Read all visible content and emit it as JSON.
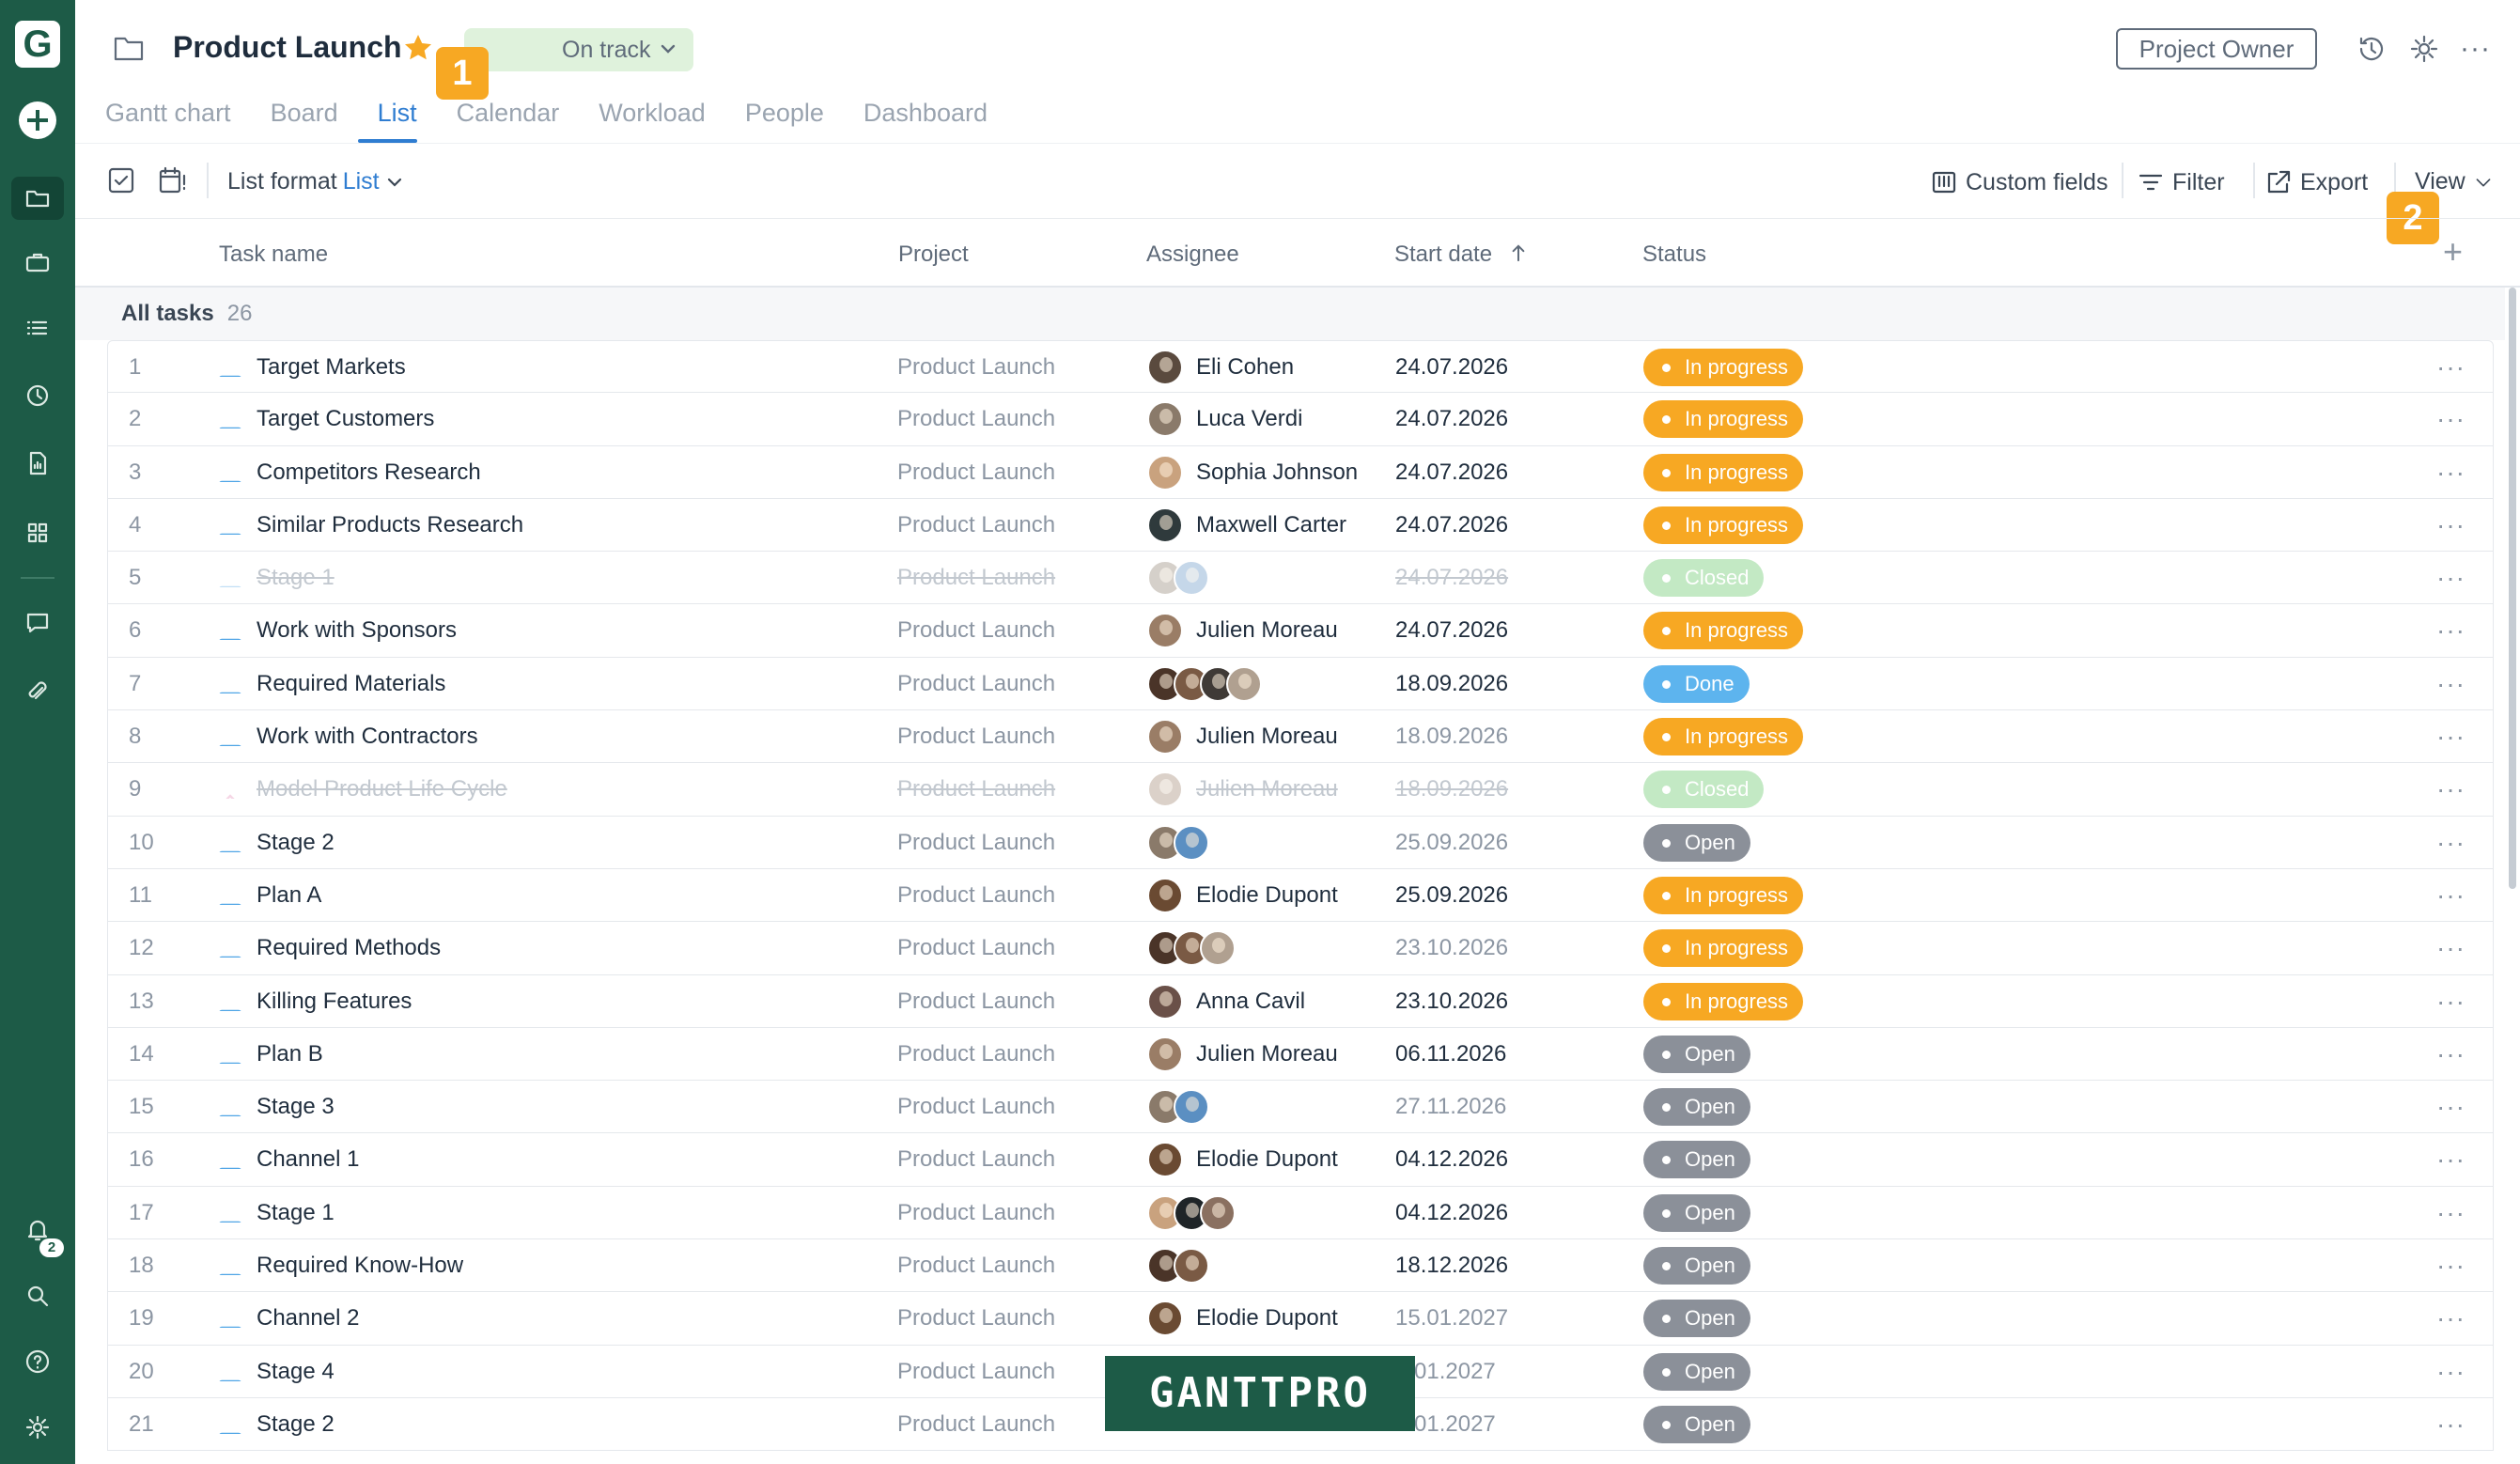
{
  "app": {
    "logo_letter": "G"
  },
  "sidebar": {
    "items": [
      {
        "name": "folder-icon",
        "active": true
      },
      {
        "name": "briefcase-icon"
      },
      {
        "name": "list-icon"
      },
      {
        "name": "clock-icon"
      },
      {
        "name": "report-icon"
      },
      {
        "name": "grid-icon"
      },
      {
        "name": "chat-icon"
      },
      {
        "name": "attachment-icon"
      }
    ],
    "notification_count": "2"
  },
  "header": {
    "title": "Product Launch",
    "status": "On track",
    "owner_button": "Project Owner",
    "tabs": [
      {
        "label": "Gantt chart"
      },
      {
        "label": "Board"
      },
      {
        "label": "List",
        "active": true
      },
      {
        "label": "Calendar"
      },
      {
        "label": "Workload"
      },
      {
        "label": "People"
      },
      {
        "label": "Dashboard"
      }
    ],
    "callout_1": "1",
    "callout_2": "2"
  },
  "toolbar": {
    "list_format_label": "List format",
    "list_format_value": "List",
    "custom_fields": "Custom fields",
    "filter": "Filter",
    "export": "Export",
    "view": "View"
  },
  "table": {
    "columns": {
      "task_name": "Task name",
      "project": "Project",
      "assignee": "Assignee",
      "start_date": "Start date",
      "status": "Status"
    },
    "group": {
      "label": "All tasks",
      "count": "26"
    },
    "rows": [
      {
        "num": "1",
        "name": "Target Markets",
        "project": "Product Launch",
        "assignee": "Eli Cohen",
        "avatars": [
          "#5a4a3e"
        ],
        "date": "24.07.2026",
        "date_muted": false,
        "status": "In progress",
        "kind": "progress"
      },
      {
        "num": "2",
        "name": "Target Customers",
        "project": "Product Launch",
        "assignee": "Luca Verdi",
        "avatars": [
          "#8a7a6a"
        ],
        "date": "24.07.2026",
        "date_muted": false,
        "status": "In progress",
        "kind": "progress"
      },
      {
        "num": "3",
        "name": "Competitors Research",
        "project": "Product Launch",
        "assignee": "Sophia Johnson",
        "avatars": [
          "#c9a27e"
        ],
        "date": "24.07.2026",
        "date_muted": false,
        "status": "In progress",
        "kind": "progress"
      },
      {
        "num": "4",
        "name": "Similar Products Research",
        "project": "Product Launch",
        "assignee": "Maxwell Carter",
        "avatars": [
          "#2f3a3c"
        ],
        "date": "24.07.2026",
        "date_muted": false,
        "status": "In progress",
        "kind": "progress"
      },
      {
        "num": "5",
        "name": "Stage 1",
        "project": "Product Launch",
        "assignee": "",
        "avatars": [
          "#8a7a6a",
          "#5b8fc2"
        ],
        "date": "24.07.2026",
        "date_muted": false,
        "status": "Closed",
        "kind": "closed",
        "closed": true
      },
      {
        "num": "6",
        "name": "Work with Sponsors",
        "project": "Product Launch",
        "assignee": "Julien Moreau",
        "avatars": [
          "#9a7d66"
        ],
        "date": "24.07.2026",
        "date_muted": false,
        "status": "In progress",
        "kind": "progress"
      },
      {
        "num": "7",
        "name": "Required Materials",
        "project": "Product Launch",
        "assignee": "",
        "avatars": [
          "#4a3428",
          "#7a5a44",
          "#3f3a36",
          "#b0a090"
        ],
        "date": "18.09.2026",
        "date_muted": false,
        "status": "Done",
        "kind": "done"
      },
      {
        "num": "8",
        "name": "Work with Contractors",
        "project": "Product Launch",
        "assignee": "Julien Moreau",
        "avatars": [
          "#9a7d66"
        ],
        "date": "18.09.2026",
        "date_muted": true,
        "status": "In progress",
        "kind": "progress"
      },
      {
        "num": "9",
        "name": "Model Product Life Cycle",
        "project": "Product Launch",
        "assignee": "Julien Moreau",
        "avatars": [
          "#9a7d66"
        ],
        "date": "18.09.2026",
        "date_muted": false,
        "status": "Closed",
        "kind": "closed",
        "closed": true,
        "milestone": true
      },
      {
        "num": "10",
        "name": "Stage 2",
        "project": "Product Launch",
        "assignee": "",
        "avatars": [
          "#8a7a6a",
          "#5b8fc2"
        ],
        "date": "25.09.2026",
        "date_muted": true,
        "status": "Open",
        "kind": "open"
      },
      {
        "num": "11",
        "name": "Plan A",
        "project": "Product Launch",
        "assignee": "Elodie Dupont",
        "avatars": [
          "#6a4a32"
        ],
        "date": "25.09.2026",
        "date_muted": false,
        "status": "In progress",
        "kind": "progress"
      },
      {
        "num": "12",
        "name": "Required Methods",
        "project": "Product Launch",
        "assignee": "",
        "avatars": [
          "#4a3428",
          "#7a5a44",
          "#b0a090"
        ],
        "date": "23.10.2026",
        "date_muted": true,
        "status": "In progress",
        "kind": "progress"
      },
      {
        "num": "13",
        "name": "Killing Features",
        "project": "Product Launch",
        "assignee": "Anna Cavil",
        "avatars": [
          "#6a5048"
        ],
        "date": "23.10.2026",
        "date_muted": false,
        "status": "In progress",
        "kind": "progress"
      },
      {
        "num": "14",
        "name": "Plan B",
        "project": "Product Launch",
        "assignee": "Julien Moreau",
        "avatars": [
          "#9a7d66"
        ],
        "date": "06.11.2026",
        "date_muted": false,
        "status": "Open",
        "kind": "open"
      },
      {
        "num": "15",
        "name": "Stage 3",
        "project": "Product Launch",
        "assignee": "",
        "avatars": [
          "#8a7a6a",
          "#5b8fc2"
        ],
        "date": "27.11.2026",
        "date_muted": true,
        "status": "Open",
        "kind": "open"
      },
      {
        "num": "16",
        "name": "Channel 1",
        "project": "Product Launch",
        "assignee": "Elodie Dupont",
        "avatars": [
          "#6a4a32"
        ],
        "date": "04.12.2026",
        "date_muted": false,
        "status": "Open",
        "kind": "open"
      },
      {
        "num": "17",
        "name": "Stage 1",
        "project": "Product Launch",
        "assignee": "",
        "avatars": [
          "#c9a27e",
          "#1f2528",
          "#8a7060"
        ],
        "date": "04.12.2026",
        "date_muted": false,
        "status": "Open",
        "kind": "open"
      },
      {
        "num": "18",
        "name": "Required Know-How",
        "project": "Product Launch",
        "assignee": "",
        "avatars": [
          "#4a3428",
          "#7a5a44"
        ],
        "date": "18.12.2026",
        "date_muted": false,
        "status": "Open",
        "kind": "open"
      },
      {
        "num": "19",
        "name": "Channel 2",
        "project": "Product Launch",
        "assignee": "Elodie Dupont",
        "avatars": [
          "#6a4a32"
        ],
        "date": "15.01.2027",
        "date_muted": true,
        "status": "Open",
        "kind": "open"
      },
      {
        "num": "20",
        "name": "Stage 4",
        "project": "Product Launch",
        "assignee": "",
        "avatars": [],
        "date": "2.01.2027",
        "date_muted": true,
        "status": "Open",
        "kind": "open"
      },
      {
        "num": "21",
        "name": "Stage 2",
        "project": "Product Launch",
        "assignee": "",
        "avatars": [],
        "date": "2.01.2027",
        "date_muted": true,
        "status": "Open",
        "kind": "open"
      }
    ]
  },
  "watermark": "GANTTPRO",
  "colors": {
    "sidebar": "#1d5b47",
    "accent": "#2f7dd1",
    "in_progress": "#f7a823",
    "done": "#5db4ee",
    "open": "#8b9099",
    "closed": "#c3e9c4",
    "callout": "#f7a823"
  }
}
